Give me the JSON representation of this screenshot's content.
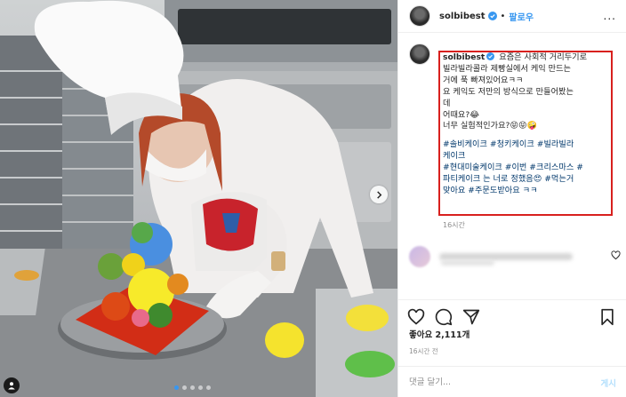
{
  "header": {
    "username": "solbibest",
    "follow_label": "팔로우",
    "more_label": "..."
  },
  "caption": {
    "username": "solbibest",
    "lines": [
      "요즘은 사회적 거리두기로",
      "빌라빌라콜라 제빵실에서 케익 만드는",
      "거에 푹 빠져있어요ㅋㅋ",
      "요 케익도 저만의 방식으로 만들어봤는",
      "데",
      "어때요?😂",
      "너무 실험적인가요?😝😝🤪"
    ],
    "hashtags": [
      "#솔비케이크 #청키케이크 #빌라빌라",
      "케이크",
      "#현대미술케이크 #이번 #크리스마스 #",
      "파티케이크 는 너로 정했음😍 #먹는거",
      "맞아요 #주문도받아요 ㅋㅋ"
    ],
    "time": "16시간"
  },
  "likes": {
    "label": "좋아요 2,111개"
  },
  "post_time": "16시간 전",
  "add_comment": {
    "placeholder": "댓글 달기...",
    "post_label": "게시"
  },
  "colors": {
    "accent": "#3897f0",
    "highlight_box": "#d8201e",
    "hashtag": "#00376b"
  },
  "icons": [
    "verified-badge-icon",
    "more-icon",
    "heart-icon",
    "comment-icon",
    "share-icon",
    "bookmark-icon",
    "carousel-next-icon",
    "user-tag-icon"
  ],
  "carousel": {
    "total": 5,
    "active_index": 0
  }
}
